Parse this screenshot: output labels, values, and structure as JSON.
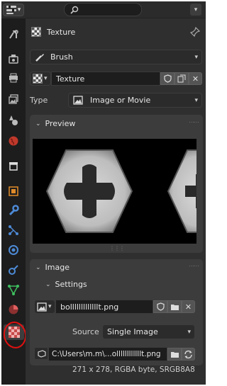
{
  "header": {
    "search_placeholder": ""
  },
  "texture_row": {
    "title": "Texture"
  },
  "context": {
    "selected": "Brush"
  },
  "datablock": {
    "name": "Texture"
  },
  "type": {
    "label": "Type",
    "value": "Image or Movie"
  },
  "preview": {
    "label": "Preview"
  },
  "image_panel": {
    "label": "Image",
    "settings_label": "Settings",
    "image_name": "bolllllllllllllt.png"
  },
  "source": {
    "label": "Source",
    "value": "Single Image"
  },
  "filepath": {
    "value": "C:\\Users\\m.m\\...ollllllllllllt.png"
  },
  "image_info": "271 x 278,  RGBA byte,  SRGB8A8",
  "sidebar_tabs": [
    {
      "name": "tool-tab",
      "icon": "wrench-screwdriver-icon"
    },
    {
      "name": "render-tab",
      "icon": "camera-back-icon"
    },
    {
      "name": "output-tab",
      "icon": "printer-icon"
    },
    {
      "name": "view-layer-tab",
      "icon": "image-stack-icon"
    },
    {
      "name": "scene-tab",
      "icon": "cone-sphere-icon"
    },
    {
      "name": "world-tab",
      "icon": "globe-icon"
    },
    {
      "name": "collection-tab",
      "icon": "box-icon"
    },
    {
      "name": "object-tab",
      "icon": "orange-square-icon"
    },
    {
      "name": "modifiers-tab",
      "icon": "blue-wrench-icon"
    },
    {
      "name": "particles-tab",
      "icon": "particles-icon"
    },
    {
      "name": "physics-tab",
      "icon": "physics-icon"
    },
    {
      "name": "constraints-tab",
      "icon": "constraint-icon"
    },
    {
      "name": "data-tab",
      "icon": "vertex-triangle-icon"
    },
    {
      "name": "material-tab",
      "icon": "material-sphere-icon"
    },
    {
      "name": "texture-tab",
      "icon": "checker-texture-icon"
    }
  ],
  "colors": {
    "accent": "#4772b3",
    "annotation": "#e01010"
  }
}
